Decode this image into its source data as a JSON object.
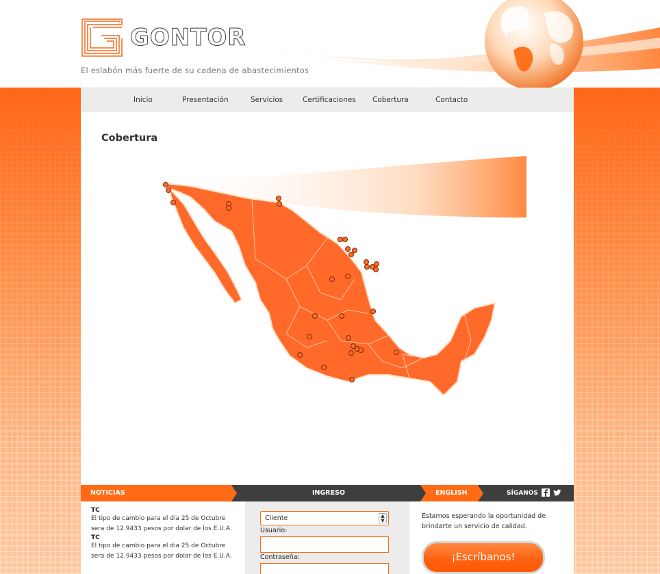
{
  "brand": {
    "logo_text": "GONTOR",
    "tagline": "El eslabón más fuerte de su cadena de abastecimientos"
  },
  "nav": {
    "items": [
      {
        "label": "Inicio"
      },
      {
        "label": "Presentación"
      },
      {
        "label": "Servicios"
      },
      {
        "label": "Certificaciones"
      },
      {
        "label": "Cobertura"
      },
      {
        "label": "Contacto"
      }
    ]
  },
  "page": {
    "title": "Cobertura"
  },
  "bottom_bar": {
    "news_label": "NOTICIAS",
    "login_label": "INGRESO",
    "english_label": "ENGLISH",
    "follow_label": "SÍGANOS",
    "icons": [
      "facebook-icon",
      "twitter-icon"
    ]
  },
  "news": {
    "items": [
      {
        "title": "TC",
        "body": "El tipo de cambio para el dia 25 de Octubre sera de 12.9433 pesos por dolar de los E.U.A."
      },
      {
        "title": "TC",
        "body": "El tipo de cambio para el dia 25 de Octubre sera de 12.9433 pesos por dolar de los E.U.A."
      }
    ]
  },
  "login": {
    "select_value": "Cliente",
    "user_label": "Usuario:",
    "password_label": "Contraseña:"
  },
  "contact": {
    "text": "Estamos esperando la oportunidad de brindarte un servicio de calidad.",
    "button_label": "¡Escríbanos!"
  },
  "colors": {
    "accent": "#ff6a14",
    "dark_bar": "#3e3e3e",
    "nav_bg": "#ececec",
    "map_fill": "#ff6a2a"
  }
}
